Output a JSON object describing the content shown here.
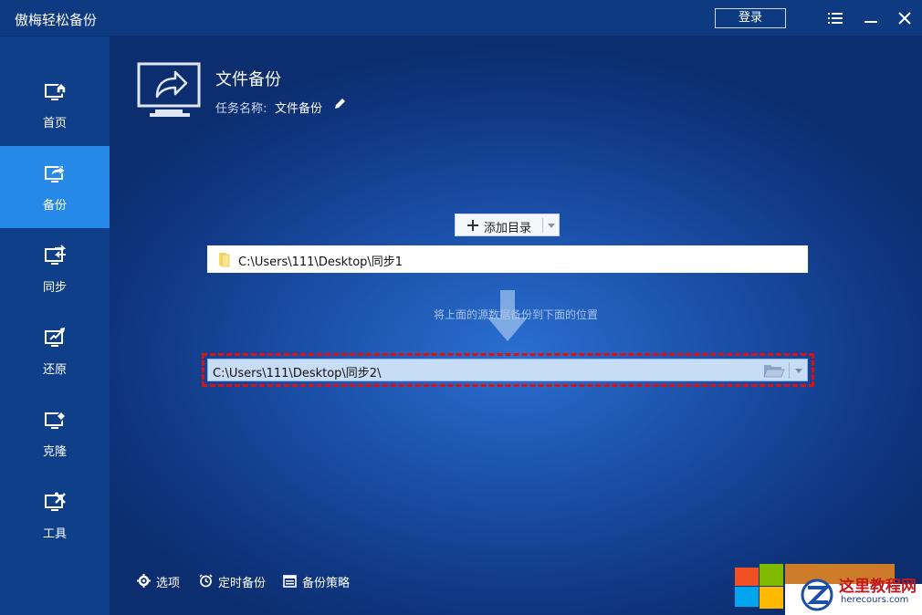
{
  "window": {
    "title": "傲梅轻松备份",
    "login_label": "登录"
  },
  "sidebar": {
    "items": [
      {
        "label": "首页",
        "icon": "home-monitor-icon"
      },
      {
        "label": "备份",
        "icon": "backup-icon",
        "active": true
      },
      {
        "label": "同步",
        "icon": "sync-icon"
      },
      {
        "label": "还原",
        "icon": "restore-icon"
      },
      {
        "label": "克隆",
        "icon": "clone-icon"
      },
      {
        "label": "工具",
        "icon": "tools-icon"
      }
    ]
  },
  "task": {
    "title": "文件备份",
    "name_label": "任务名称:",
    "name_value": "文件备份"
  },
  "source": {
    "add_label": "添加目录",
    "path": "C:\\Users\\111\\Desktop\\同步1"
  },
  "hint": "将上面的源数据备份到下面的位置",
  "destination": {
    "path": "C:\\Users\\111\\Desktop\\同步2\\"
  },
  "footer": {
    "options_label": "选项",
    "schedule_label": "定时备份",
    "strategy_label": "备份策略"
  },
  "watermark": {
    "text": "这里教程网",
    "sub": "herecours.com"
  },
  "colors": {
    "accent": "#2789e8",
    "highlight": "#e01010"
  }
}
